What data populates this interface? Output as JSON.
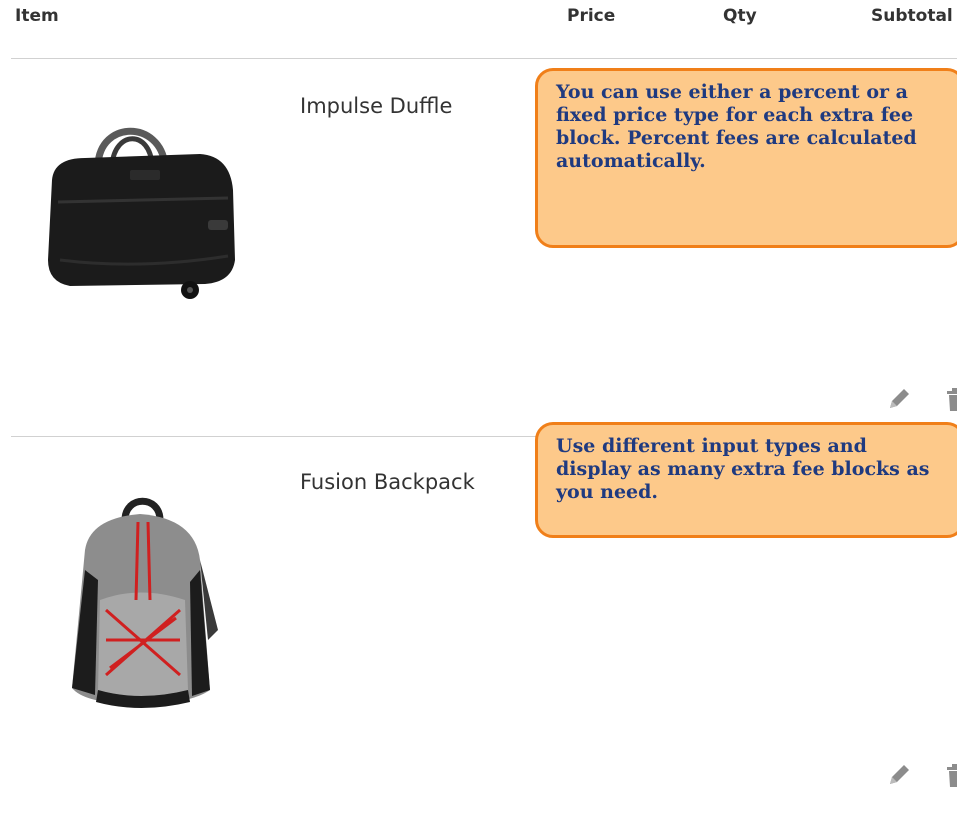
{
  "cart_table": {
    "headers": {
      "item": "Item",
      "price": "Price",
      "qty": "Qty",
      "subtotal": "Subtotal"
    },
    "items": [
      {
        "name": "Impulse Duffle",
        "image_icon": "duffle-bag-image"
      },
      {
        "name": "Fusion Backpack",
        "image_icon": "backpack-image"
      }
    ],
    "action_icons": [
      "pencil-edit-icon",
      "trash-delete-icon"
    ]
  },
  "callouts": [
    {
      "text": "You can use either a percent or a fixed price type for each extra fee block. Percent fees are calculated automatically."
    },
    {
      "text": "Use different input types and display as many extra fee blocks as you need."
    }
  ],
  "colors": {
    "callout_fill": "#fdc98a",
    "callout_border": "#f07f19",
    "callout_text": "#1f3a80",
    "separator": "#d1d1d1"
  }
}
